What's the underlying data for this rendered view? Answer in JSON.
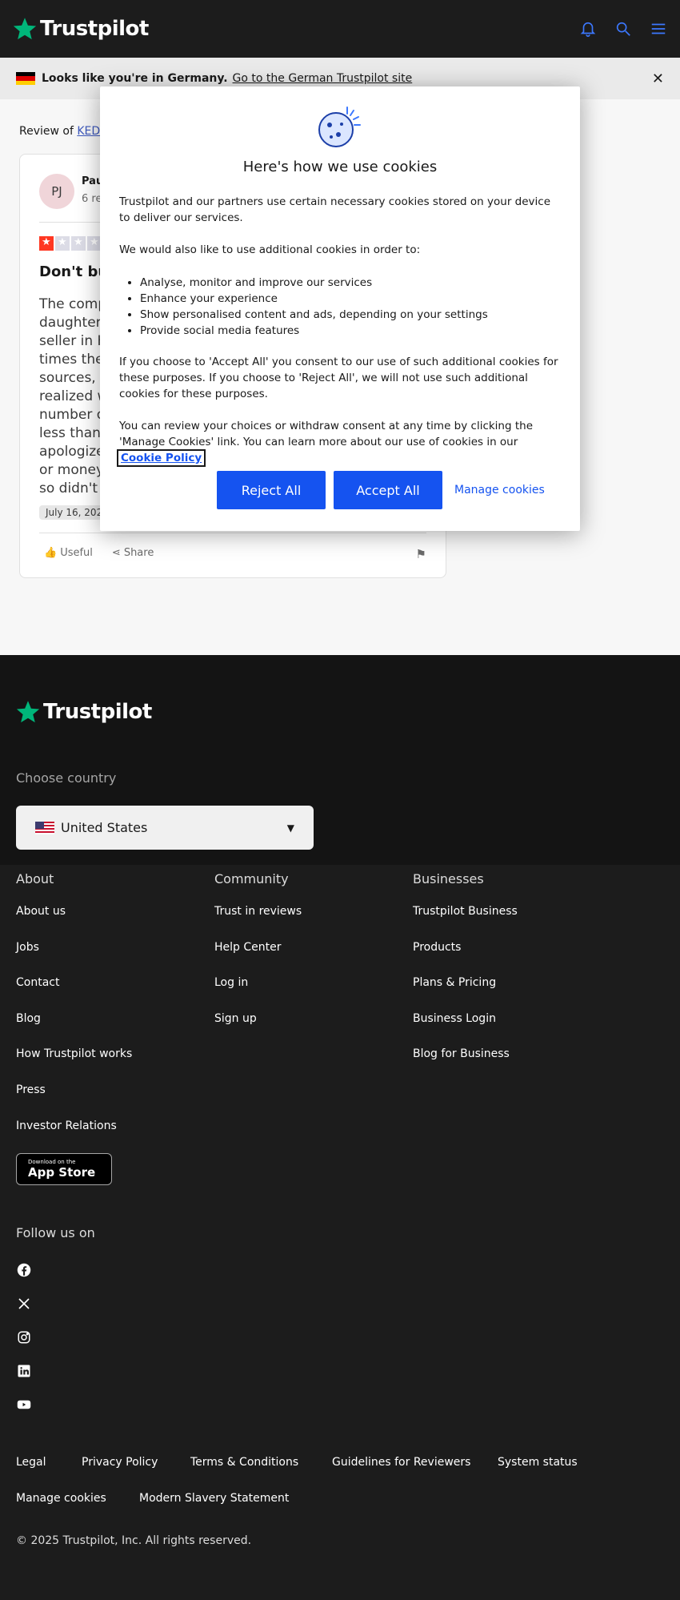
{
  "header": {
    "logo_text": "Trustpilot",
    "icons": [
      "bell-icon",
      "search-icon",
      "menu-icon"
    ]
  },
  "banner": {
    "bold_text": "Looks like you're in Germany.",
    "link_text": "Go to the German Trustpilot site"
  },
  "review": {
    "review_of_prefix": "Review of",
    "company_link": "KEDM",
    "avatar_initials": "PJ",
    "reviewer_name": "Pau",
    "reviewer_count": "6 re",
    "rating": 1,
    "title": "Don't buy",
    "body_lines": [
      "The comp",
      "daughter w",
      "seller in Hu",
      "times the p",
      "sources, a",
      "realized w",
      "number of",
      "less than t",
      "apologized",
      "or money r",
      "so didn't k"
    ],
    "date": "July 16, 2025",
    "useful_label": "Useful",
    "share_label": "Share"
  },
  "cookie_modal": {
    "title": "Here's how we use cookies",
    "para1": "Trustpilot and our partners use certain necessary cookies stored on your device to deliver our services.",
    "para2": "We would also like to use additional cookies in order to:",
    "list": [
      "Analyse, monitor and improve our services",
      "Enhance your experience",
      "Show personalised content and ads, depending on your settings",
      "Provide social media features"
    ],
    "para3": "If you choose to 'Accept All' you consent to our use of such additional cookies for these purposes. If you choose to 'Reject All', we will not use such additional cookies for these purposes.",
    "para4": "You can review your choices or withdraw consent at any time by clicking the 'Manage Cookies' link. You can learn more about our use of cookies in our",
    "policy_link": "Cookie Policy",
    "reject_label": "Reject All",
    "accept_label": "Accept All",
    "manage_label": "Manage cookies"
  },
  "footer": {
    "logo_text": "Trustpilot",
    "choose_country": "Choose country",
    "selected_country": "United States",
    "columns": [
      {
        "heading": "About",
        "links": [
          "About us",
          "Jobs",
          "Contact",
          "Blog",
          "How Trustpilot works",
          "Press",
          "Investor Relations"
        ]
      },
      {
        "heading": "Community",
        "links": [
          "Trust in reviews",
          "Help Center",
          "Log in",
          "Sign up"
        ]
      },
      {
        "heading": "Businesses",
        "links": [
          "Trustpilot Business",
          "Products",
          "Plans & Pricing",
          "Business Login",
          "Blog for Business"
        ]
      }
    ],
    "app_store_small": "Download on the",
    "app_store_big": "App Store",
    "follow_us": "Follow us on",
    "social_icons": [
      "facebook-icon",
      "x-icon",
      "instagram-icon",
      "linkedin-icon",
      "youtube-icon"
    ],
    "legal_links": [
      "Legal",
      "Privacy Policy",
      "Terms & Conditions",
      "Guidelines for Reviewers",
      "System status",
      "Manage cookies",
      "Modern Slavery Statement"
    ],
    "copyright": "© 2025 Trustpilot, Inc. All rights reserved."
  },
  "colors": {
    "brand_green": "#00b67a",
    "accent_blue": "#1553f0",
    "star_red": "#ff3722"
  }
}
